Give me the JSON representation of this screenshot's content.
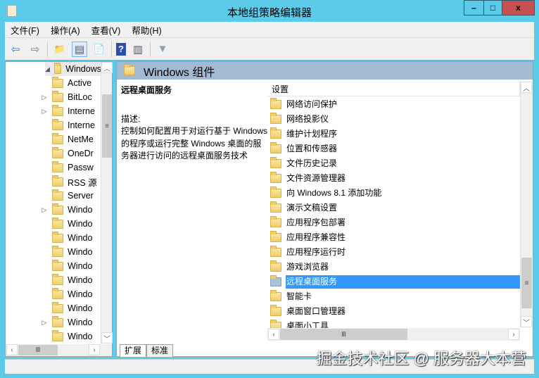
{
  "window": {
    "title": "本地组策略编辑器",
    "minimize": "–",
    "maximize": "□",
    "close": "x"
  },
  "menu": [
    "文件(F)",
    "操作(A)",
    "查看(V)",
    "帮助(H)"
  ],
  "toolbar": [
    {
      "icon": "back-arrow-icon",
      "glyph": "⇦"
    },
    {
      "icon": "forward-arrow-icon",
      "glyph": "⇨"
    },
    {
      "icon": "up-folder-icon",
      "glyph": "📁"
    },
    {
      "icon": "show-hide-console-tree-icon",
      "glyph": "▤"
    },
    {
      "icon": "export-list-icon",
      "glyph": "📄"
    },
    {
      "icon": "help-icon",
      "glyph": "?"
    },
    {
      "icon": "show-action-pane-icon",
      "glyph": "▥"
    },
    {
      "icon": "filter-icon",
      "glyph": "▼"
    }
  ],
  "tree": {
    "root": "Windows",
    "items": [
      {
        "label": "Active",
        "expandable": false
      },
      {
        "label": "BitLoc",
        "expandable": true
      },
      {
        "label": "Interne",
        "expandable": true
      },
      {
        "label": "Interne",
        "expandable": false
      },
      {
        "label": "NetMe",
        "expandable": false
      },
      {
        "label": "OneDr",
        "expandable": false
      },
      {
        "label": "Passw",
        "expandable": false
      },
      {
        "label": "RSS 源",
        "expandable": false
      },
      {
        "label": "Server",
        "expandable": false
      },
      {
        "label": "Windo",
        "expandable": true
      },
      {
        "label": "Windo",
        "expandable": false
      },
      {
        "label": "Windo",
        "expandable": false
      },
      {
        "label": "Windo",
        "expandable": false
      },
      {
        "label": "Windo",
        "expandable": false
      },
      {
        "label": "Windo",
        "expandable": false
      },
      {
        "label": "Windo",
        "expandable": false
      },
      {
        "label": "Windo",
        "expandable": false
      },
      {
        "label": "Windo",
        "expandable": true
      },
      {
        "label": "Windo",
        "expandable": false
      }
    ]
  },
  "right": {
    "header": "Windows 组件",
    "selected_title": "远程桌面服务",
    "desc_label": "描述:",
    "desc_text": "控制如何配置用于对运行基于 Windows 的程序或运行完整 Windows 桌面的服务器进行访问的远程桌面服务技术",
    "column_header": "设置",
    "items": [
      "网络访问保护",
      "网络投影仪",
      "维护计划程序",
      "位置和传感器",
      "文件历史记录",
      "文件资源管理器",
      "向 Windows 8.1 添加功能",
      "演示文稿设置",
      "应用程序包部署",
      "应用程序兼容性",
      "应用程序运行时",
      "游戏浏览器",
      "远程桌面服务",
      "智能卡",
      "桌面窗口管理器",
      "桌面小工具"
    ],
    "selected_index": 12,
    "tabs": [
      "扩展",
      "标准"
    ],
    "active_tab": 0
  },
  "watermark": "掘金技术社区 @ 服务器大本营",
  "colors": {
    "frame": "#5ccbea",
    "selection": "#3399ff",
    "header": "#a3bad3",
    "close": "#c75050"
  }
}
